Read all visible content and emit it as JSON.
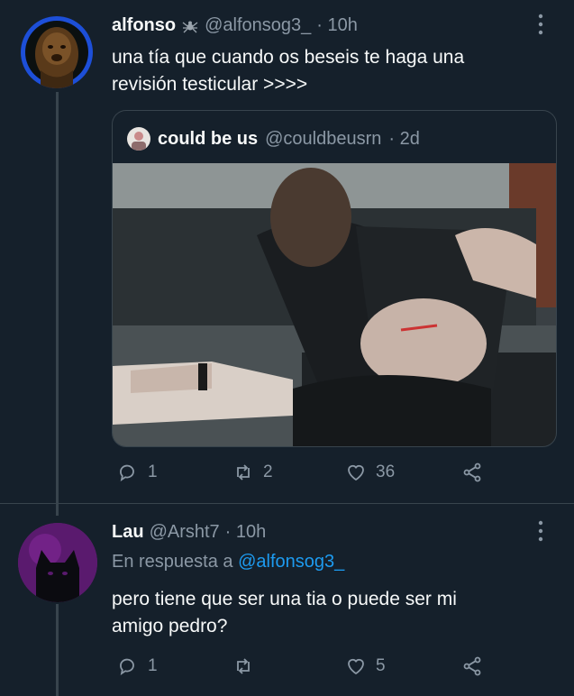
{
  "tweet": {
    "author_name": "alfonso",
    "author_handle": "@alfonsog3_",
    "time": "· 10h",
    "text_line1": "una tía que cuando os beseis te haga una",
    "text_line2": "revisión testicular >>>>",
    "quoted": {
      "author_name": "could be us",
      "author_handle": "@couldbeusrn",
      "time": "· 2d"
    },
    "actions": {
      "replies": "1",
      "retweets": "2",
      "likes": "36"
    }
  },
  "reply": {
    "author_name": "Lau",
    "author_handle": "@Arsht7",
    "time": "· 10h",
    "replying_to_prefix": "En respuesta a",
    "replying_to_handle": "@alfonsog3_",
    "text_line1": "pero tiene que ser una tia o puede ser mi",
    "text_line2": "amigo pedro?",
    "actions": {
      "replies": "1",
      "retweets": "",
      "likes": "5"
    }
  },
  "icons": {
    "reply": "reply-icon",
    "retweet": "retweet-icon",
    "like": "heart-icon",
    "share": "share-icon",
    "more": "more-icon",
    "badge": "spider-emoji-icon"
  },
  "colors": {
    "background": "#15202b",
    "secondary_text": "#8b98a5",
    "link": "#1d9bf0",
    "border": "#38444d"
  }
}
